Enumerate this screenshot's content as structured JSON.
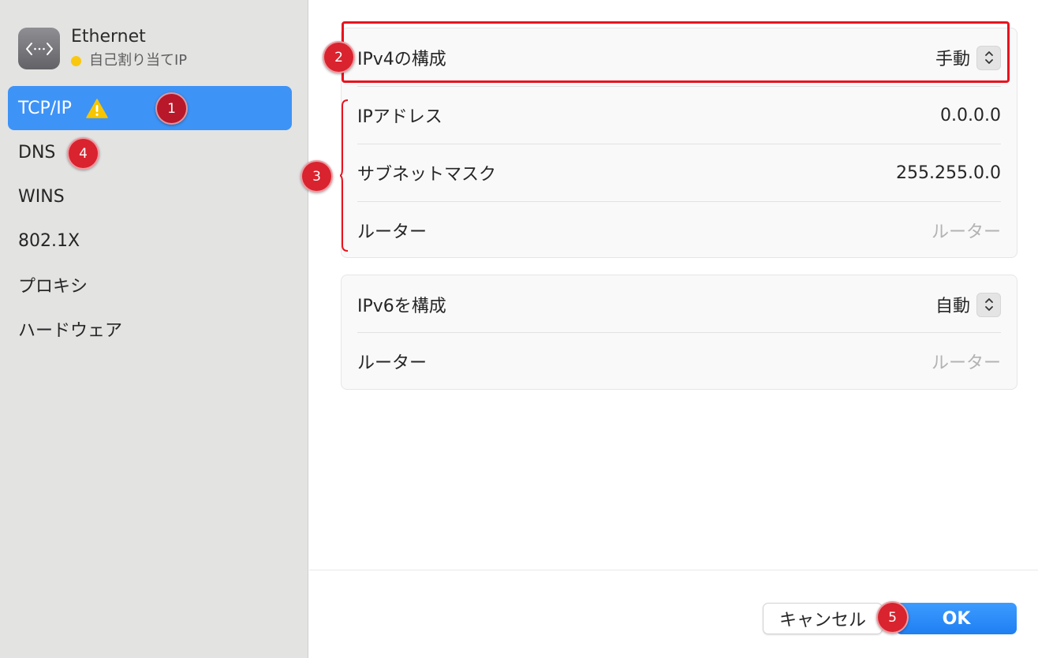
{
  "interface": {
    "name": "Ethernet",
    "status": "自己割り当てIP",
    "status_color": "#f9c80e"
  },
  "sidebar": {
    "items": [
      {
        "label": "TCP/IP",
        "active": true,
        "warning": true
      },
      {
        "label": "DNS"
      },
      {
        "label": "WINS"
      },
      {
        "label": "802.1X"
      },
      {
        "label": "プロキシ"
      },
      {
        "label": "ハードウェア"
      }
    ]
  },
  "ipv4": {
    "configure_label": "IPv4の構成",
    "configure_value": "手動",
    "ip_label": "IPアドレス",
    "ip_value": "0.0.0.0",
    "subnet_label": "サブネットマスク",
    "subnet_value": "255.255.0.0",
    "router_label": "ルーター",
    "router_placeholder": "ルーター"
  },
  "ipv6": {
    "configure_label": "IPv6を構成",
    "configure_value": "自動",
    "router_label": "ルーター",
    "router_placeholder": "ルーター"
  },
  "buttons": {
    "cancel": "キャンセル",
    "ok": "OK"
  },
  "annotations": {
    "badge1": "1",
    "badge2": "2",
    "badge3": "3",
    "badge4": "4",
    "badge5": "5",
    "highlight_color": "#e8131e"
  },
  "colors": {
    "accent": "#3e93f6",
    "ok_button": "#1f7ff2",
    "warning": "#f7c600"
  }
}
